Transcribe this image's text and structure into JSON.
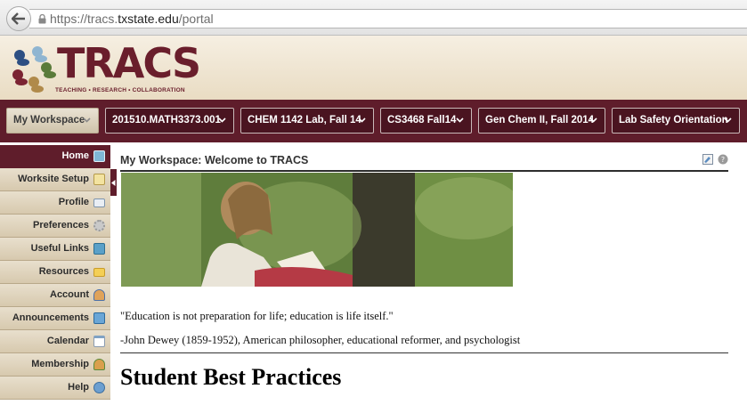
{
  "browser": {
    "url_prefix": "https://tracs.",
    "url_domain": "txstate.edu",
    "url_path": "/portal"
  },
  "header": {
    "logo_text": "TRACS",
    "tagline": "TEACHING • RESEARCH • COLLABORATION",
    "logo_colors": [
      "#2d4f83",
      "#8fb5d1",
      "#5a7b3a",
      "#b08a4a",
      "#7b2433"
    ]
  },
  "site_tabs": [
    {
      "label": "My Workspace",
      "active": true
    },
    {
      "label": "201510.MATH3373.001",
      "active": false
    },
    {
      "label": "CHEM 1142 Lab, Fall 14",
      "active": false
    },
    {
      "label": "CS3468 Fall14",
      "active": false
    },
    {
      "label": "Gen Chem II, Fall 2014",
      "active": false
    },
    {
      "label": "Lab Safety Orientation",
      "active": false
    }
  ],
  "tool_menu": [
    {
      "label": "Home",
      "icon": "home-icon",
      "active": true
    },
    {
      "label": "Worksite Setup",
      "icon": "worksite-setup-icon",
      "active": false
    },
    {
      "label": "Profile",
      "icon": "profile-card-icon",
      "active": false
    },
    {
      "label": "Preferences",
      "icon": "preferences-gear-icon",
      "active": false
    },
    {
      "label": "Useful Links",
      "icon": "useful-links-icon",
      "active": false
    },
    {
      "label": "Resources",
      "icon": "folder-icon",
      "active": false
    },
    {
      "label": "Account",
      "icon": "account-user-icon",
      "active": false
    },
    {
      "label": "Announcements",
      "icon": "megaphone-icon",
      "active": false
    },
    {
      "label": "Calendar",
      "icon": "calendar-icon",
      "active": false
    },
    {
      "label": "Membership",
      "icon": "membership-group-icon",
      "active": false
    },
    {
      "label": "Help",
      "icon": "help-icon",
      "active": false
    }
  ],
  "main": {
    "title": "My Workspace: Welcome to TRACS",
    "quote": "\"Education is not preparation for life; education is life itself.\"",
    "attribution": "-John Dewey (1859-1952), American philosopher, educational reformer, and psychologist",
    "section_heading": "Student Best Practices"
  },
  "colors": {
    "maroon": "#5f1d2b",
    "tan": "#e8dfcd"
  }
}
